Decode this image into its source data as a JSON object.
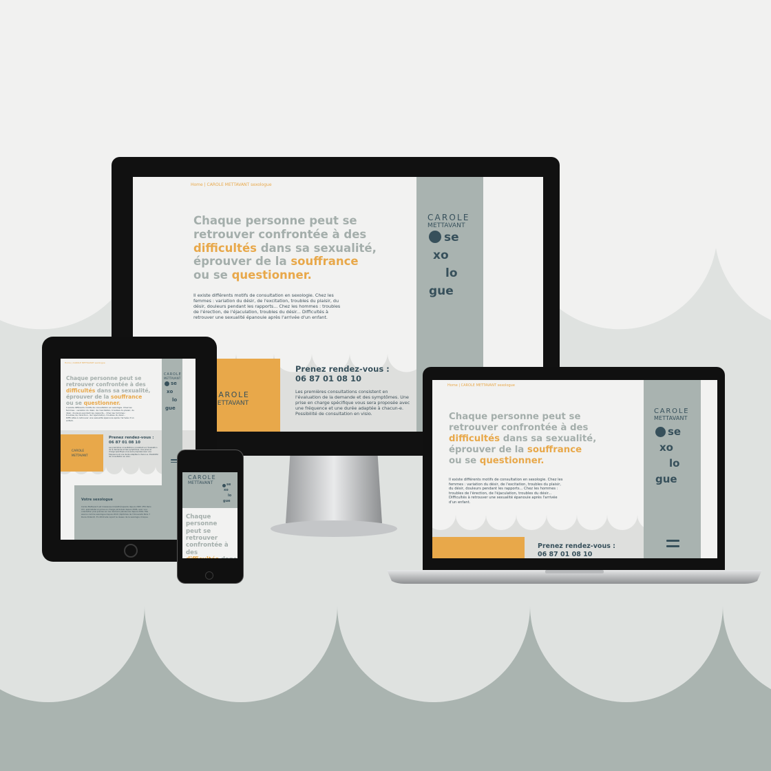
{
  "site": {
    "breadcrumb": "Home | CAROLE METTAVANT sexologue",
    "headline": {
      "l1": "Chaque personne peut se",
      "l2": "retrouver confrontée à des",
      "hl1": "difficultés",
      "l3b": " dans sa sexualité,",
      "l4a": "éprouver de la ",
      "hl2": "souffrance",
      "l5a": "ou se ",
      "hl3": "questionner."
    },
    "intro": "Il existe différents motifs de consultation en sexologie. Chez les femmes : variation du désir, de l'excitation, troubles du plaisir, du désir, douleurs pendant les rapports... Chez les hommes : troubles de l'érection, de l'éjaculation, troubles du désir... Difficultés à retrouver une sexualité épanouie après l'arrivée d'un enfant.",
    "logo": {
      "first": "CAROLE",
      "last": "METTAVANT",
      "s1": "se",
      "s2": "xo",
      "s3": "lo",
      "s4": "gue"
    },
    "rdv_title": "Prenez rendez-vous :",
    "phone": "06 87 01 08 10",
    "rdv_text": "Les premières consultations consistent en l'évaluation de la demande et des symptômes. Une prise en charge spécifique vous sera proposée avec une fréquence et une durée adaptée à chacun-e. Possibilité de consultation en visio.",
    "about_title": "Votre sexologue",
    "about_text": "Carole Mettavant est masseuse-kinésithérapeute depuis 2005 (IFSI Paris XV), spécialisée en prise en charge périnéale depuis 2006, avec une orientation plus précise sur les douleurs pelviennes depuis 2016. Elle exerce comme sexologue depuis 2019 (diplômée de l'Université Paris 7 Denis Diderot). En 2019 elle rejoint le réseau de la sexologie clinique."
  },
  "colors": {
    "background": "#f1f1f0",
    "wave": "#aab4b0",
    "accent": "#e8a84a",
    "navy": "#37505b",
    "grey_band": "#a9b3b0"
  }
}
